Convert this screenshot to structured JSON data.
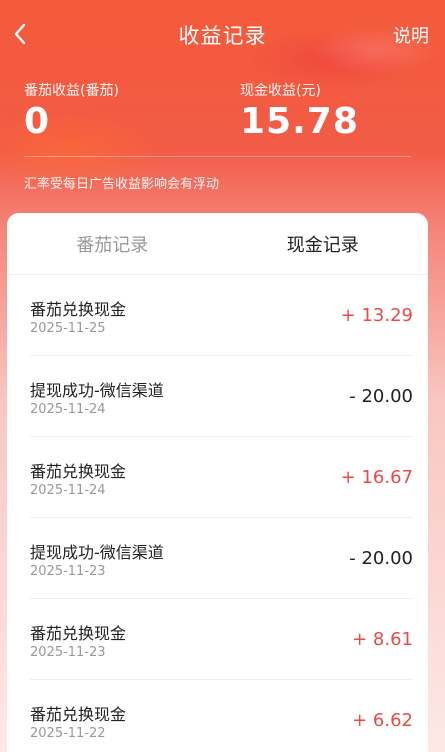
{
  "nav": {
    "title": "收益记录",
    "help": "说明"
  },
  "stats": {
    "tomato": {
      "label": "番茄收益(番茄)",
      "value": "0"
    },
    "cash": {
      "label": "现金收益(元)",
      "value": "15.78"
    }
  },
  "note": "汇率受每日广告收益影响会有浮动",
  "tabs": [
    {
      "label": "番茄记录",
      "active": false
    },
    {
      "label": "现金记录",
      "active": true
    }
  ],
  "records": [
    {
      "title": "番茄兑换现金",
      "date": "2025-11-25",
      "amount": "+ 13.29",
      "sign": "plus"
    },
    {
      "title": "提现成功-微信渠道",
      "date": "2025-11-24",
      "amount": "- 20.00",
      "sign": "minus"
    },
    {
      "title": "番茄兑换现金",
      "date": "2025-11-24",
      "amount": "+ 16.67",
      "sign": "plus"
    },
    {
      "title": "提现成功-微信渠道",
      "date": "2025-11-23",
      "amount": "- 20.00",
      "sign": "minus"
    },
    {
      "title": "番茄兑换现金",
      "date": "2025-11-23",
      "amount": "+ 8.61",
      "sign": "plus"
    },
    {
      "title": "番茄兑换现金",
      "date": "2025-11-22",
      "amount": "+ 6.62",
      "sign": "plus"
    }
  ],
  "colors": {
    "accent": "#f25b46",
    "positive": "#e84a4a",
    "negative": "#222222"
  },
  "icons": {
    "back": "chevron-left-icon"
  }
}
